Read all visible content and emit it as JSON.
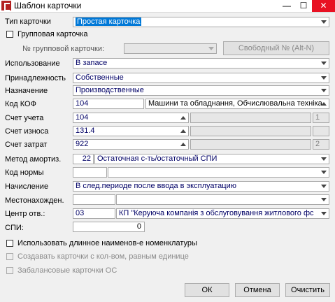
{
  "window": {
    "title": "Шаблон карточки"
  },
  "form": {
    "type_label": "Тип карточки",
    "type_value": "Простая карточка",
    "group_card_label": "Групповая карточка",
    "group_no_label": "№ групповой карточки:",
    "free_no_button": "Свободный № (Alt-N)",
    "usage_label": "Использование",
    "usage_value": "В запасе",
    "ownership_label": "Принадлежность",
    "ownership_value": "Собственные",
    "purpose_label": "Назначение",
    "purpose_value": "Производственные",
    "kof_label": "Код КОФ",
    "kof_code": "104",
    "kof_name": "Машини та обладнання, Обчислювальна техніка",
    "account_label": "Счет учета",
    "account_value": "104",
    "account_num": "1",
    "wear_label": "Счет износа",
    "wear_value": "131.4",
    "cost_label": "Счет затрат",
    "cost_value": "922",
    "cost_num": "2",
    "amort_label": "Метод амортиз.",
    "amort_code": "22",
    "amort_name": "Остаточная с-ть/остаточный СПИ",
    "norm_label": "Код нормы",
    "accrual_label": "Начисление",
    "accrual_value": "В след.периоде после ввода в эксплуатацию",
    "location_label": "Местонахожден.",
    "center_label": "Центр отв.:",
    "center_code": "03",
    "center_name": "КП \"Керуюча компанія з обслуговування житлового фс",
    "spi_label": "СПИ:",
    "spi_value": "0"
  },
  "options": {
    "long_name": "Использовать длинное наименов-е номенклатуры",
    "create_cards": "Создавать карточки с кол-вом, равным единице",
    "offbalance": "Забалансовые карточки ОС"
  },
  "buttons": {
    "ok": "ОК",
    "cancel": "Отмена",
    "clear": "Очистить"
  }
}
